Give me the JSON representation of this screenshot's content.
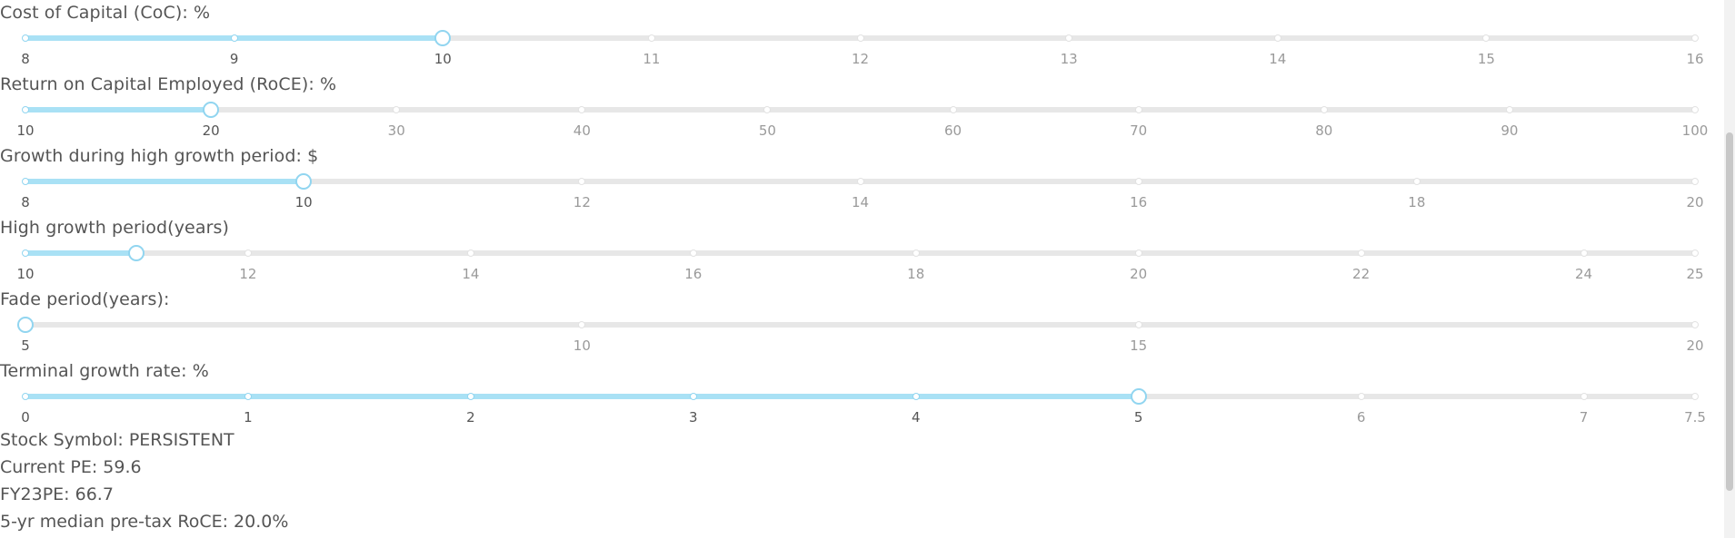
{
  "sliders": [
    {
      "label": "Cost of Capital (CoC): %",
      "min": 8,
      "max": 16,
      "value": 10,
      "marks": [
        {
          "v": 8,
          "t": "8"
        },
        {
          "v": 9,
          "t": "9"
        },
        {
          "v": 10,
          "t": "10"
        },
        {
          "v": 11,
          "t": "11"
        },
        {
          "v": 12,
          "t": "12"
        },
        {
          "v": 13,
          "t": "13"
        },
        {
          "v": 14,
          "t": "14"
        },
        {
          "v": 15,
          "t": "15"
        },
        {
          "v": 16,
          "t": "16"
        }
      ]
    },
    {
      "label": "Return on Capital Employed (RoCE): %",
      "min": 10,
      "max": 100,
      "value": 20,
      "marks": [
        {
          "v": 10,
          "t": "10"
        },
        {
          "v": 20,
          "t": "20"
        },
        {
          "v": 30,
          "t": "30"
        },
        {
          "v": 40,
          "t": "40"
        },
        {
          "v": 50,
          "t": "50"
        },
        {
          "v": 60,
          "t": "60"
        },
        {
          "v": 70,
          "t": "70"
        },
        {
          "v": 80,
          "t": "80"
        },
        {
          "v": 90,
          "t": "90"
        },
        {
          "v": 100,
          "t": "100"
        }
      ]
    },
    {
      "label": "Growth during high growth period: $",
      "min": 8,
      "max": 20,
      "value": 10,
      "marks": [
        {
          "v": 8,
          "t": "8"
        },
        {
          "v": 10,
          "t": "10"
        },
        {
          "v": 12,
          "t": "12"
        },
        {
          "v": 14,
          "t": "14"
        },
        {
          "v": 16,
          "t": "16"
        },
        {
          "v": 18,
          "t": "18"
        },
        {
          "v": 20,
          "t": "20"
        }
      ]
    },
    {
      "label": "High growth period(years)",
      "min": 10,
      "max": 25,
      "value": 11,
      "marks": [
        {
          "v": 10,
          "t": "10"
        },
        {
          "v": 12,
          "t": "12"
        },
        {
          "v": 14,
          "t": "14"
        },
        {
          "v": 16,
          "t": "16"
        },
        {
          "v": 18,
          "t": "18"
        },
        {
          "v": 20,
          "t": "20"
        },
        {
          "v": 22,
          "t": "22"
        },
        {
          "v": 24,
          "t": "24"
        },
        {
          "v": 25,
          "t": "25"
        }
      ]
    },
    {
      "label": "Fade period(years):",
      "min": 5,
      "max": 20,
      "value": 5,
      "marks": [
        {
          "v": 5,
          "t": "5"
        },
        {
          "v": 10,
          "t": "10"
        },
        {
          "v": 15,
          "t": "15"
        },
        {
          "v": 20,
          "t": "20"
        }
      ]
    },
    {
      "label": "Terminal growth rate: %",
      "min": 0,
      "max": 7.5,
      "value": 5,
      "marks": [
        {
          "v": 0,
          "t": "0"
        },
        {
          "v": 1,
          "t": "1"
        },
        {
          "v": 2,
          "t": "2"
        },
        {
          "v": 3,
          "t": "3"
        },
        {
          "v": 4,
          "t": "4"
        },
        {
          "v": 5,
          "t": "5"
        },
        {
          "v": 6,
          "t": "6"
        },
        {
          "v": 7,
          "t": "7"
        },
        {
          "v": 7.5,
          "t": "7.5"
        }
      ]
    }
  ],
  "info": {
    "stock_symbol": "Stock Symbol: PERSISTENT",
    "current_pe": "Current PE: 59.6",
    "fy23_pe": "FY23PE: 66.7",
    "median_roce": "5-yr median pre-tax RoCE: 20.0%"
  },
  "colors": {
    "accent": "#91d5f0",
    "fill": "#a9e1f5",
    "track": "#e7e7e7"
  }
}
